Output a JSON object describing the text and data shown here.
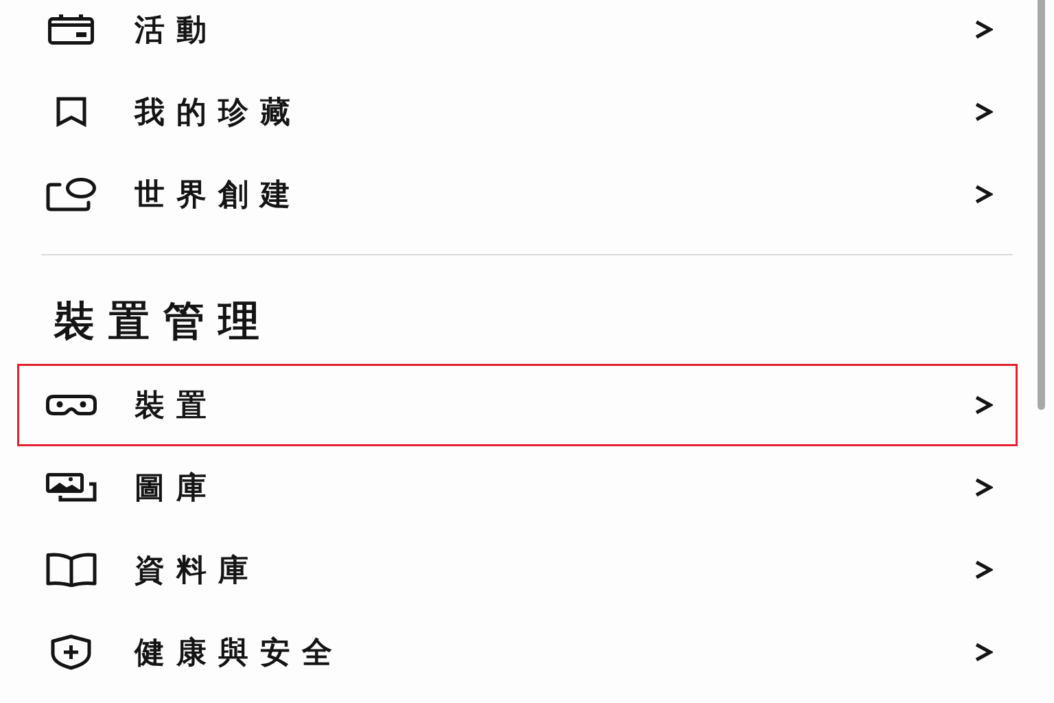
{
  "menu_items": [
    {
      "label": "活動",
      "highlighted": false
    },
    {
      "label": "我的珍藏",
      "highlighted": false
    },
    {
      "label": "世界創建",
      "highlighted": false
    }
  ],
  "device_section": {
    "heading": "裝置管理",
    "items": [
      {
        "label": "裝置",
        "highlighted": true
      },
      {
        "label": "圖庫",
        "highlighted": false
      },
      {
        "label": "資料庫",
        "highlighted": false
      },
      {
        "label": "健康與安全",
        "highlighted": false
      }
    ]
  }
}
